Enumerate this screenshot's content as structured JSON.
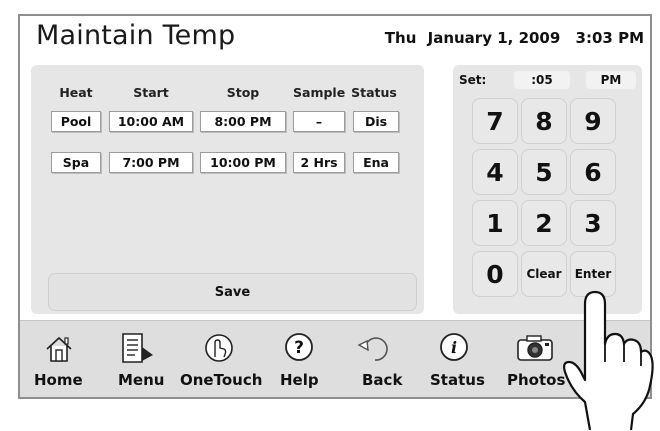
{
  "header": {
    "title": "Maintain Temp",
    "day": "Thu",
    "date": "January 1, 2009",
    "time": "3:03 PM"
  },
  "schedule": {
    "columns": [
      "Heat",
      "Start",
      "Stop",
      "Sample",
      "Status"
    ],
    "rows": [
      {
        "heat": "Pool",
        "start": "10:00 AM",
        "stop": "8:00 PM",
        "sample": "–",
        "status": "Dis"
      },
      {
        "heat": "Spa",
        "start": "7:00 PM",
        "stop": "10:00 PM",
        "sample": "2 Hrs",
        "status": "Ena"
      }
    ],
    "save_label": "Save"
  },
  "keypad": {
    "set_label": "Set:",
    "minutes": ":05",
    "ampm": "PM",
    "keys": [
      "7",
      "8",
      "9",
      "4",
      "5",
      "6",
      "1",
      "2",
      "3",
      "0",
      "Clear",
      "Enter"
    ]
  },
  "nav": [
    {
      "label": "Home",
      "icon": "home-icon"
    },
    {
      "label": "Menu",
      "icon": "menu-icon"
    },
    {
      "label": "OneTouch",
      "icon": "onetouch-icon"
    },
    {
      "label": "Help",
      "icon": "help-icon"
    },
    {
      "label": "Back",
      "icon": "back-icon"
    },
    {
      "label": "Status",
      "icon": "status-icon"
    },
    {
      "label": "Photos",
      "icon": "camera-icon"
    }
  ],
  "colors": {
    "panel_bg": "#e6e6e6",
    "bar_bg": "#dedede",
    "frame_border": "#8f8f8f"
  }
}
